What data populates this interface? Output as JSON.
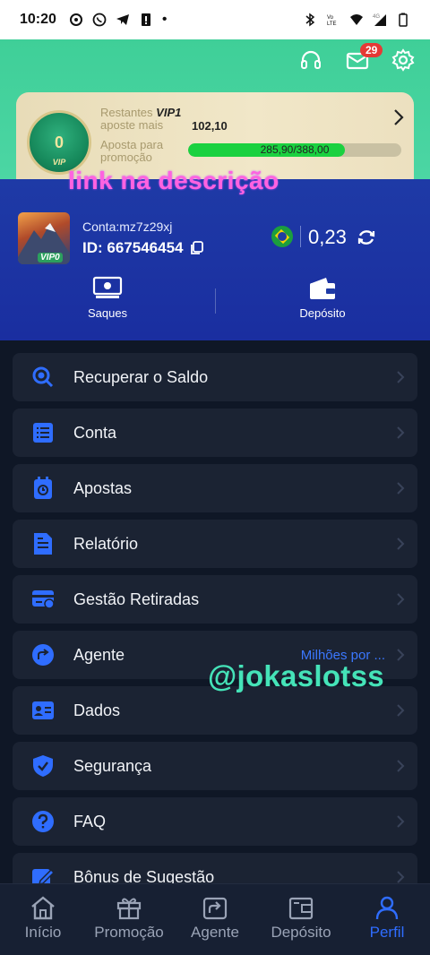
{
  "status_bar": {
    "time": "10:20"
  },
  "header": {
    "mail_badge": "29"
  },
  "vip": {
    "medal_level": "0",
    "medal_tag": "VIP",
    "line1_prefix": "Restantes ",
    "line1_level": "VIP1",
    "line2": "aposte mais",
    "amount": "102,10",
    "promo_label": "Aposta para promoção",
    "progress_text": "285,90/388,00",
    "progress_fraction": 0.737
  },
  "overlay": {
    "link_text": "link na descrição",
    "handle": "@jokaslotss"
  },
  "profile": {
    "avatar_tag": "VIP0",
    "account": "Conta:mz7z29xj",
    "id": "ID: 667546454",
    "balance": "0,23"
  },
  "actions": {
    "withdraw": "Saques",
    "deposit": "Depósito"
  },
  "menu": [
    {
      "label": "Recuperar o Saldo",
      "icon": "search-coin-icon"
    },
    {
      "label": "Conta",
      "icon": "list-icon"
    },
    {
      "label": "Apostas",
      "icon": "stopwatch-icon"
    },
    {
      "label": "Relatório",
      "icon": "report-icon"
    },
    {
      "label": "Gestão Retiradas",
      "icon": "card-icon"
    },
    {
      "label": "Agente",
      "icon": "share-icon",
      "extra": "Milhões por ..."
    },
    {
      "label": "Dados",
      "icon": "id-card-icon"
    },
    {
      "label": "Segurança",
      "icon": "shield-icon"
    },
    {
      "label": "FAQ",
      "icon": "question-icon"
    },
    {
      "label": "Bônus de Sugestão",
      "icon": "edit-icon"
    }
  ],
  "bottom_nav": [
    {
      "label": "Início",
      "icon": "home-icon"
    },
    {
      "label": "Promoção",
      "icon": "gift-icon"
    },
    {
      "label": "Agente",
      "icon": "share-icon"
    },
    {
      "label": "Depósito",
      "icon": "wallet-icon"
    },
    {
      "label": "Perfil",
      "icon": "person-icon",
      "active": true
    }
  ],
  "colors": {
    "accent": "#2f6dff",
    "header_green": "#3fcf98",
    "panel_blue": "#1e3aa6",
    "progress_green": "#1bd140"
  }
}
